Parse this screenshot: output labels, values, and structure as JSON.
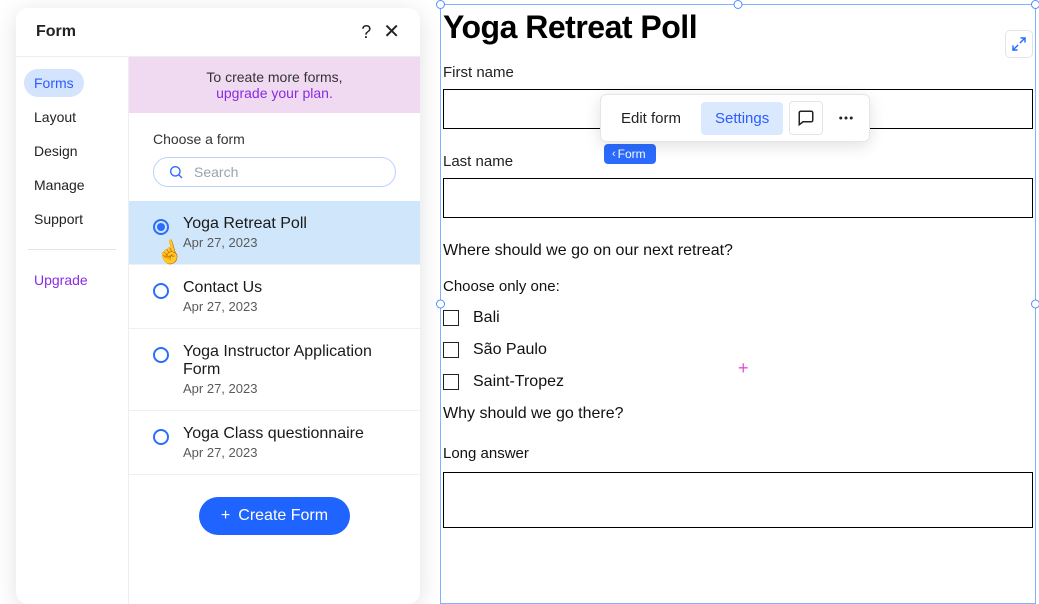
{
  "panel": {
    "title": "Form",
    "help_glyph": "?",
    "close_glyph": "✕"
  },
  "sidenav": {
    "items": [
      {
        "label": "Forms",
        "active": true
      },
      {
        "label": "Layout",
        "active": false
      },
      {
        "label": "Design",
        "active": false
      },
      {
        "label": "Manage",
        "active": false
      },
      {
        "label": "Support",
        "active": false
      }
    ],
    "upgrade_label": "Upgrade"
  },
  "banner": {
    "line1": "To create more forms,",
    "line2": "upgrade your plan."
  },
  "form_picker": {
    "choose_label": "Choose a form",
    "search_placeholder": "Search",
    "items": [
      {
        "title": "Yoga Retreat Poll",
        "date": "Apr 27, 2023",
        "selected": true
      },
      {
        "title": "Contact Us",
        "date": "Apr 27, 2023",
        "selected": false
      },
      {
        "title": "Yoga Instructor Application Form",
        "date": "Apr 27, 2023",
        "selected": false
      },
      {
        "title": "Yoga Class questionnaire",
        "date": "Apr 27, 2023",
        "selected": false
      }
    ],
    "create_label": "Create Form",
    "plus_glyph": "+"
  },
  "toolbar": {
    "edit_label": "Edit form",
    "settings_label": "Settings",
    "breadcrumb_label": "Form",
    "breadcrumb_chevron": "‹"
  },
  "form": {
    "title": "Yoga Retreat Poll",
    "first_name_label": "First name",
    "last_name_label": "Last name",
    "q1": "Where should we go on our next retreat?",
    "choose_one": "Choose only one:",
    "options": [
      "Bali",
      "São Paulo",
      "Saint-Tropez"
    ],
    "q2": "Why should we go there?",
    "long_answer_label": "Long answer"
  },
  "glyphs": {
    "cursor": "☝",
    "expand": "⤢",
    "dots": "⋯",
    "plus_marker": "+"
  }
}
